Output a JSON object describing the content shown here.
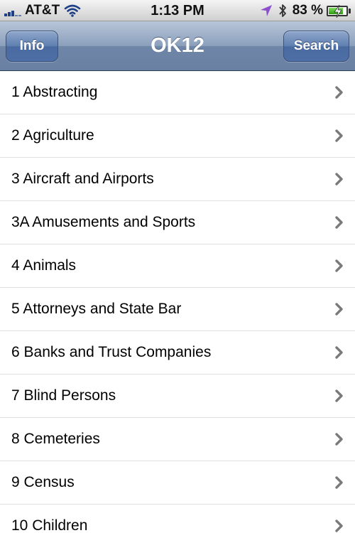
{
  "status_bar": {
    "carrier": "AT&T",
    "time": "1:13 PM",
    "battery_percent": "83 %",
    "battery_level": 0.83,
    "icons": [
      "signal-icon",
      "wifi-icon",
      "location-icon",
      "bluetooth-icon",
      "battery-icon"
    ]
  },
  "nav": {
    "title": "OK12",
    "left_button": "Info",
    "right_button": "Search"
  },
  "items": [
    {
      "label": "1 Abstracting"
    },
    {
      "label": "2 Agriculture"
    },
    {
      "label": "3 Aircraft and Airports"
    },
    {
      "label": "3A Amusements and Sports"
    },
    {
      "label": "4 Animals"
    },
    {
      "label": "5 Attorneys and State Bar"
    },
    {
      "label": "6 Banks and Trust Companies"
    },
    {
      "label": "7 Blind Persons"
    },
    {
      "label": "8 Cemeteries"
    },
    {
      "label": "9 Census"
    },
    {
      "label": "10 Children"
    }
  ],
  "colors": {
    "nav_bar": "#8ca0bc",
    "nav_button": "#5f7fb0",
    "chevron": "#7a7a7a",
    "location_arrow": "#8e4fcf",
    "battery_fill": "#2d9a12"
  }
}
